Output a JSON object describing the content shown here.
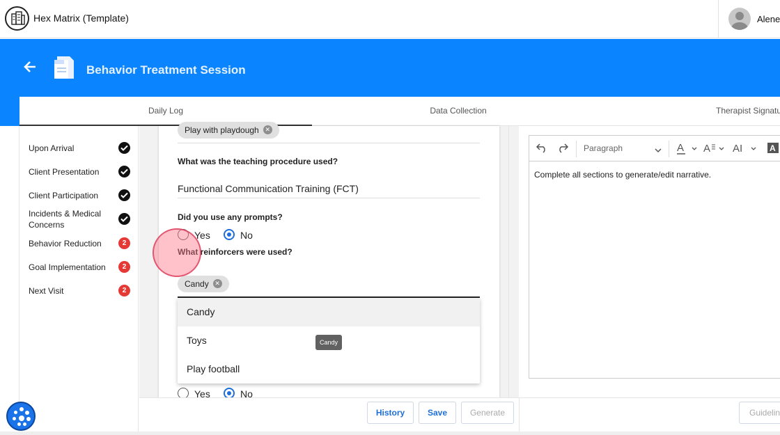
{
  "app": {
    "title": "Hex Matrix (Template)",
    "user_name": "Alene"
  },
  "header": {
    "back_icon": "arrow-left-icon",
    "doc_icon": "document-icon",
    "title": "Behavior Treatment Session"
  },
  "tabs": [
    {
      "label": "Daily Log",
      "active": true
    },
    {
      "label": "Data Collection",
      "active": false
    },
    {
      "label": "Therapist Signatu",
      "active": false
    }
  ],
  "sidebar": {
    "items": [
      {
        "label": "Upon Arrival",
        "status": "complete"
      },
      {
        "label": "Client Presentation",
        "status": "complete"
      },
      {
        "label": "Client Participation",
        "status": "complete"
      },
      {
        "label": "Incidents & Medical Concerns",
        "status": "complete"
      },
      {
        "label": "Behavior Reduction",
        "status": "count",
        "count": "2"
      },
      {
        "label": "Goal Implementation",
        "status": "count",
        "count": "2"
      },
      {
        "label": "Next Visit",
        "status": "count",
        "count": "2"
      }
    ]
  },
  "form": {
    "top_chip": "Play with playdough",
    "q_procedure": "What was the teaching procedure used?",
    "procedure_value": "Functional Communication Training (FCT)",
    "q_prompts": "Did you use any prompts?",
    "yes_label": "Yes",
    "no_label": "No",
    "prompts_selected": "No",
    "q_reinforcers": "What reinforcers were used?",
    "reinforcer_chip": "Candy",
    "dropdown_options": [
      "Candy",
      "Toys",
      "Play football"
    ],
    "tooltip": "Candy",
    "lower_yes_label": "Yes",
    "lower_no_label": "No"
  },
  "actions": {
    "history": "History",
    "save": "Save",
    "generate": "Generate",
    "guidelines": "Guidelin"
  },
  "editor": {
    "block_format": "Paragraph",
    "placeholder_text": "Complete all sections to generate/edit narrative."
  },
  "colors": {
    "primary": "#0a84ff",
    "badge": "#e53935",
    "link": "#1e6fd9"
  }
}
